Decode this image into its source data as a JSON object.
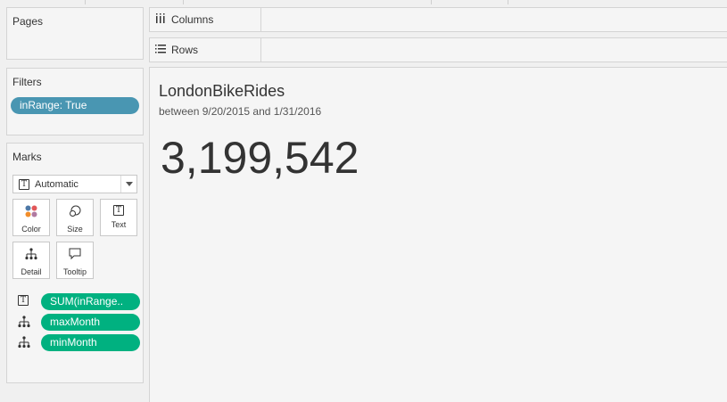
{
  "panes": {
    "pages_title": "Pages",
    "filters_title": "Filters",
    "marks_title": "Marks"
  },
  "filters": [
    {
      "label": "inRange: True",
      "color": "#4996b2"
    }
  ],
  "marks": {
    "type_dropdown": {
      "value": "Automatic",
      "icon": "text-mark-icon"
    },
    "buttons": [
      {
        "label": "Color",
        "icon": "color-dots-icon"
      },
      {
        "label": "Size",
        "icon": "size-circles-icon"
      },
      {
        "label": "Text",
        "icon": "text-box-icon"
      },
      {
        "label": "Detail",
        "icon": "detail-hierarchy-icon"
      },
      {
        "label": "Tooltip",
        "icon": "tooltip-bubble-icon"
      }
    ],
    "fields": [
      {
        "label": "SUM(inRange..",
        "icon": "text-box-icon",
        "color": "#00b180"
      },
      {
        "label": "maxMonth",
        "icon": "detail-hierarchy-icon",
        "color": "#00b180"
      },
      {
        "label": "minMonth",
        "icon": "detail-hierarchy-icon",
        "color": "#00b180"
      }
    ]
  },
  "shelves": {
    "columns_label": "Columns",
    "rows_label": "Rows"
  },
  "viz": {
    "title": "LondonBikeRides",
    "subtitle": "between 9/20/2015 and 1/31/2016",
    "value": "3,199,542"
  }
}
